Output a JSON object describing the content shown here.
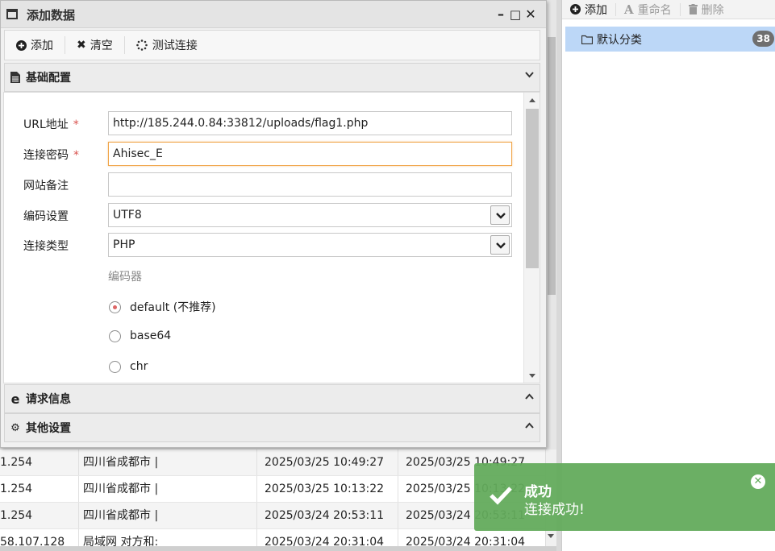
{
  "dialog": {
    "title": "添加数据",
    "controls": {
      "minimize": "–",
      "maximize": "□",
      "close": "✕"
    },
    "toolbar": {
      "add_label": "添加",
      "clear_label": "清空",
      "test_label": "测试连接"
    }
  },
  "basic": {
    "header": "基础配置",
    "url_label": "URL地址",
    "url_value": "http://185.244.0.84:33812/uploads/flag1.php",
    "password_label": "连接密码",
    "password_value": "Ahisec_E",
    "note_label": "网站备注",
    "note_value": "",
    "encoding_label": "编码设置",
    "encoding_value": "UTF8",
    "type_label": "连接类型",
    "type_value": "PHP",
    "encoder_label": "编码器",
    "encoders": [
      "default (不推荐)",
      "base64",
      "chr"
    ],
    "required_mark": "*"
  },
  "request_header": "请求信息",
  "other_header": "其他设置",
  "right_panel": {
    "add_label": "添加",
    "rename_label": "重命名",
    "delete_label": "删除",
    "category_label": "默认分类",
    "category_count": "38"
  },
  "table": {
    "rows": [
      [
        "1.254",
        "四川省成都市 |",
        "2025/03/25 10:49:27",
        "2025/03/25 10:49:27"
      ],
      [
        "1.254",
        "四川省成都市 |",
        "2025/03/25 10:13:22",
        "2025/03/25 10:13:22"
      ],
      [
        "1.254",
        "四川省成都市 |",
        "2025/03/24 20:53:11",
        "2025/03/24 20:53:11"
      ],
      [
        "58.107.128",
        "局域网 对方和:",
        "2025/03/24 20:31:04",
        "2025/03/24 20:31:04"
      ]
    ]
  },
  "toast": {
    "title": "成功",
    "message": "连接成功!"
  }
}
